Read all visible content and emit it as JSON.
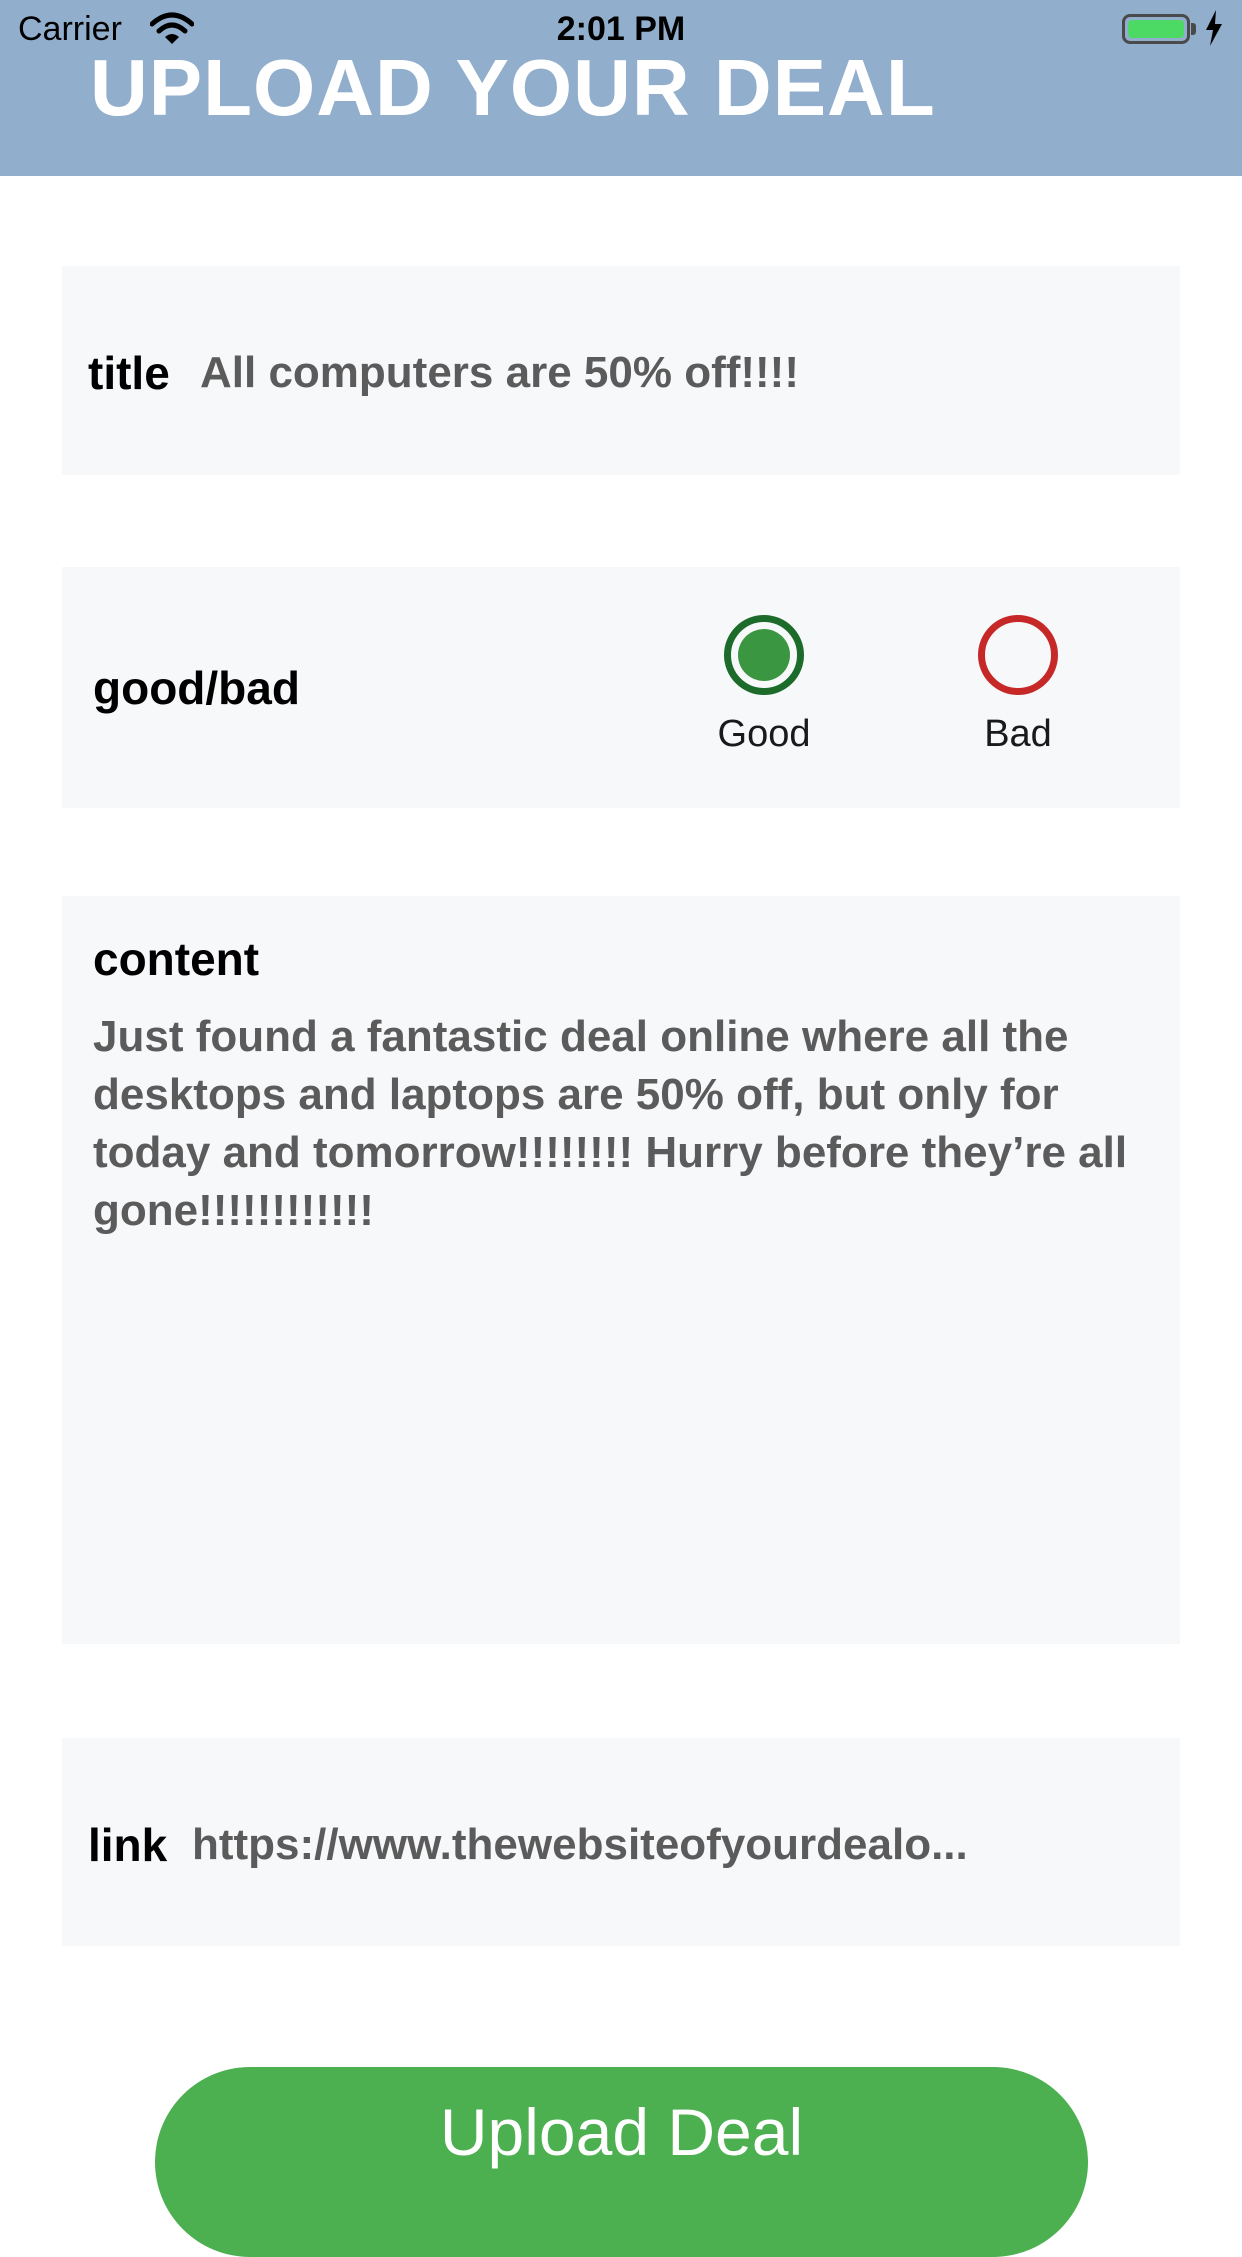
{
  "status_bar": {
    "carrier": "Carrier",
    "time": "2:01 PM",
    "battery_color": "#4cd964"
  },
  "header": {
    "title": "UPLOAD YOUR DEAL",
    "background": "#92aecd"
  },
  "form": {
    "title": {
      "label": "title",
      "value": "All computers are 50% off!!!!"
    },
    "good_bad": {
      "label": "good/bad",
      "options": [
        {
          "label": "Good",
          "selected": true,
          "color": "#1c6b2a"
        },
        {
          "label": "Bad",
          "selected": false,
          "color": "#c62828"
        }
      ]
    },
    "content": {
      "label": "content",
      "value": "Just found a fantastic deal online where all the desktops and laptops are 50% off, but only for today and tomorrow!!!!!!!! Hurry before they’re all gone!!!!!!!!!!!!"
    },
    "link": {
      "label": "link",
      "value": "https://www.thewebsiteofyourdealo..."
    }
  },
  "upload_button": {
    "label": "Upload Deal",
    "color": "#4caf50"
  }
}
